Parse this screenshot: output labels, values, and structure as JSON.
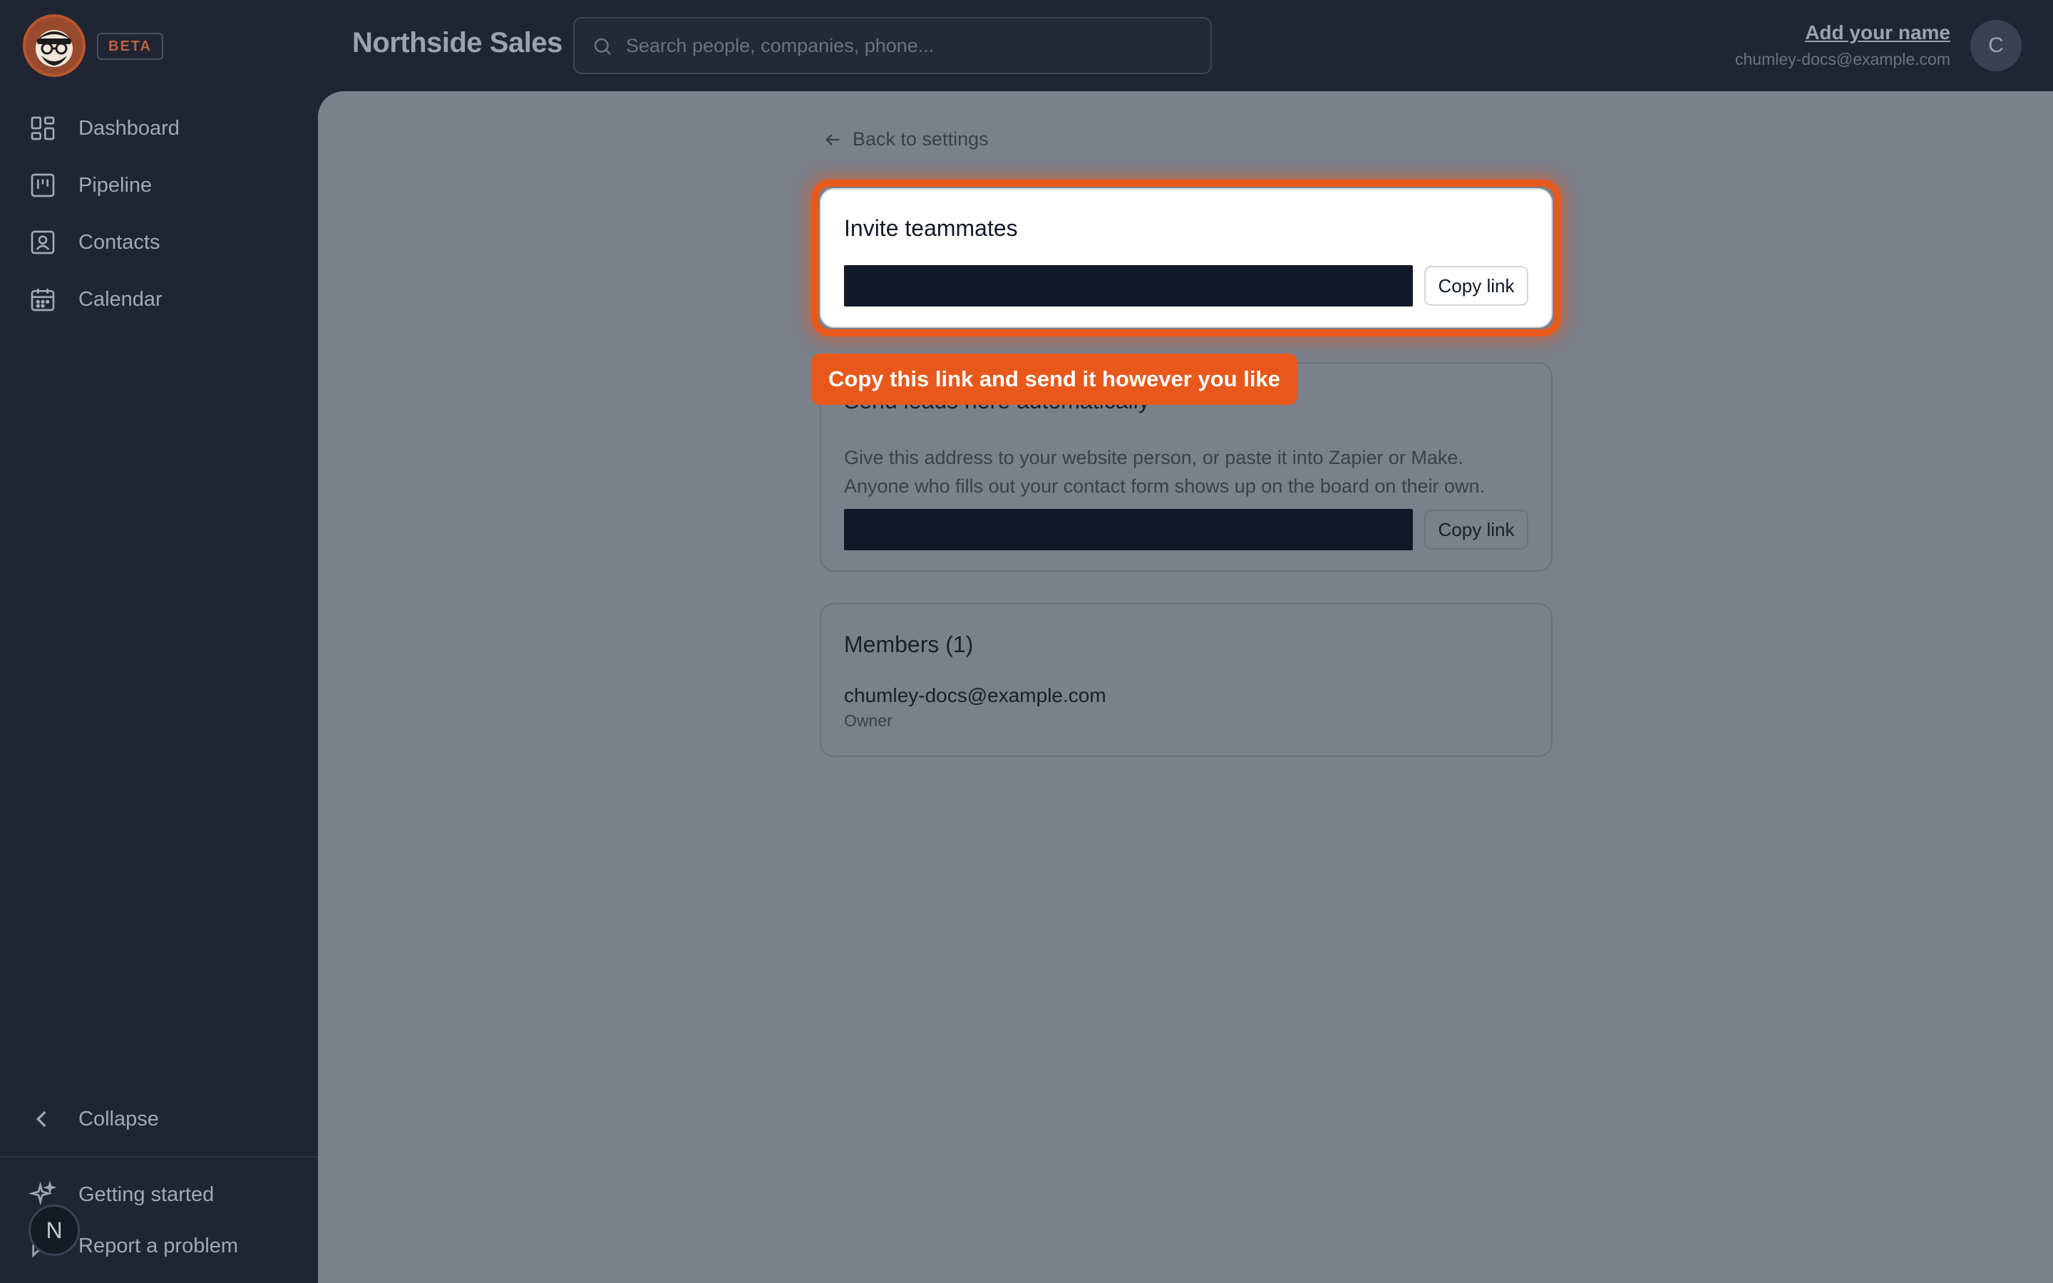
{
  "app": {
    "beta_badge": "BETA",
    "title": "Northside Sales"
  },
  "search": {
    "placeholder": "Search people, companies, phone..."
  },
  "user": {
    "name": "Add your name",
    "email": "chumley-docs@example.com",
    "avatar_initial": "C"
  },
  "sidebar": {
    "items": [
      {
        "label": "Dashboard",
        "icon": "dashboard-icon"
      },
      {
        "label": "Pipeline",
        "icon": "pipeline-icon"
      },
      {
        "label": "Contacts",
        "icon": "contacts-icon"
      },
      {
        "label": "Calendar",
        "icon": "calendar-icon"
      }
    ],
    "collapse_label": "Collapse",
    "getting_started_label": "Getting started",
    "report_problem_label": "Report a problem",
    "help_bubble_initial": "N"
  },
  "page": {
    "back_label": "Back to settings"
  },
  "invite": {
    "title": "Invite teammates",
    "copy_label": "Copy link"
  },
  "tooltip": {
    "text": "Copy this link and send it however you like"
  },
  "leads": {
    "title": "Send leads here automatically",
    "description": "Give this address to your website person, or paste it into Zapier or Make. Anyone who fills out your contact form shows up on the board on their own.",
    "copy_label": "Copy link"
  },
  "members": {
    "title": "Members (1)",
    "list": [
      {
        "email": "chumley-docs@example.com",
        "role": "Owner"
      }
    ]
  },
  "colors": {
    "accent": "#e8581b",
    "sidebar_bg": "#1f2533",
    "link_field": "#111827"
  }
}
